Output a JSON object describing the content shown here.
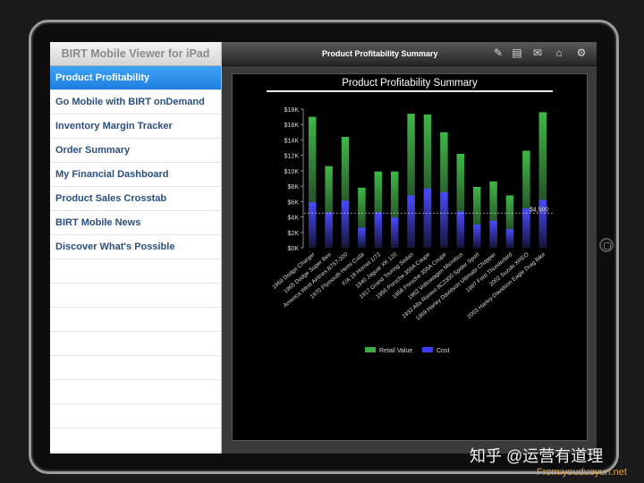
{
  "sidebar": {
    "title": "BIRT Mobile Viewer for iPad",
    "items": [
      {
        "label": "Product Profitability",
        "active": true
      },
      {
        "label": "Go Mobile with BIRT onDemand"
      },
      {
        "label": "Inventory Margin Tracker"
      },
      {
        "label": "Order Summary"
      },
      {
        "label": "My Financial Dashboard"
      },
      {
        "label": "Product Sales Crosstab"
      },
      {
        "label": "BIRT Mobile News"
      },
      {
        "label": "Discover What's Possible"
      }
    ]
  },
  "toolbar": {
    "title": "Product Profitability Summary",
    "icons": [
      "edit-icon",
      "notes-icon",
      "email-icon",
      "bookmark-icon",
      "settings-icon"
    ]
  },
  "report": {
    "title": "Product Profitability Summary"
  },
  "chart_data": {
    "type": "bar",
    "title": "Product Profitability Summary",
    "categories": [
      "1969 Dodge Charger",
      "1965 Dodge Super Bee",
      "America West Airlines B757-200",
      "1970 Plymouth Hemi Cuda",
      "F/A 18 Hornet 1/72",
      "1940 Jaguar XK 120",
      "1917 Grand Touring Sedan",
      "1956 Porsche 356A Coupe",
      "1958 Porsche 356A Coupe",
      "1962 Volkswagen Microbus",
      "1932 Alfa Romeo 8C2300 Spider Sport",
      "1969 Harley Davidson Ultimate Chopper",
      "1997 Ford Thunderbird",
      "2002 Suzuki XREO",
      "2003 Harley-Davidson Eagle Drag Bike"
    ],
    "series": [
      {
        "name": "Retail Value",
        "color": "#3dac45",
        "values": [
          17000,
          10600,
          14400,
          7800,
          9900,
          9900,
          17400,
          17300,
          15000,
          12200,
          7900,
          8600,
          6800,
          12600,
          17600
        ]
      },
      {
        "name": "Cost",
        "color": "#3c3cf0",
        "values": [
          5900,
          4600,
          6100,
          2600,
          4600,
          3900,
          6800,
          7700,
          7200,
          4700,
          3000,
          3500,
          2400,
          5100,
          6200
        ]
      }
    ],
    "ylim": [
      0,
      18000
    ],
    "yticks": [
      "$0K",
      "$2K",
      "$4K",
      "$6K",
      "$8K",
      "$10K",
      "$12K",
      "$14K",
      "$16K",
      "$18K"
    ],
    "reference_line": {
      "value": 4500,
      "label": "$4,500"
    },
    "legend_position": "bottom",
    "grid": false
  },
  "watermark": {
    "text": "知乎 @运营有道理",
    "source": "From:youduoyun.net"
  }
}
